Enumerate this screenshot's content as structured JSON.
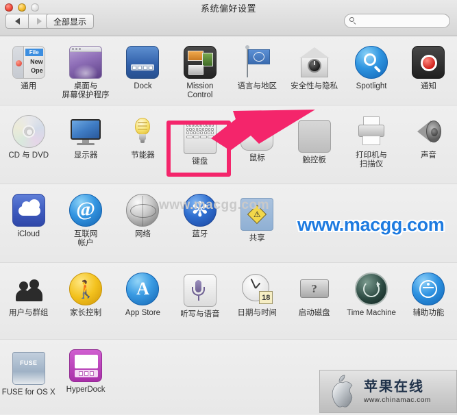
{
  "window": {
    "title": "系统偏好设置",
    "traffic_lights": [
      "close",
      "minimize",
      "zoom"
    ]
  },
  "toolbar": {
    "back_label": "◀",
    "forward_label": "▶",
    "show_all_label": "全部显示",
    "search": {
      "value": "",
      "placeholder": "",
      "icon": "search-icon"
    }
  },
  "rows": [
    {
      "items": [
        {
          "label": "通用",
          "icon": "general-icon",
          "file_text": "File",
          "new_text": "New",
          "open_text": "Ope"
        },
        {
          "label": "桌面与\n屏幕保护程序",
          "icon": "desktop-screensaver-icon"
        },
        {
          "label": "Dock",
          "icon": "dock-icon"
        },
        {
          "label": "Mission\nControl",
          "icon": "mission-control-icon"
        },
        {
          "label": "语言与地区",
          "icon": "language-region-icon"
        },
        {
          "label": "安全性与隐私",
          "icon": "security-privacy-icon"
        },
        {
          "label": "Spotlight",
          "icon": "spotlight-icon"
        },
        {
          "label": "通知",
          "icon": "notifications-icon"
        }
      ]
    },
    {
      "items": [
        {
          "label": "CD 与 DVD",
          "icon": "cd-dvd-icon"
        },
        {
          "label": "显示器",
          "icon": "displays-icon"
        },
        {
          "label": "节能器",
          "icon": "energy-saver-icon"
        },
        {
          "label": "键盘",
          "icon": "keyboard-icon",
          "highlighted": true
        },
        {
          "label": "鼠标",
          "icon": "mouse-icon"
        },
        {
          "label": "触控板",
          "icon": "trackpad-icon"
        },
        {
          "label": "打印机与\n扫描仪",
          "icon": "printers-scanners-icon"
        },
        {
          "label": "声音",
          "icon": "sound-icon"
        }
      ]
    },
    {
      "items": [
        {
          "label": "iCloud",
          "icon": "icloud-icon"
        },
        {
          "label": "互联网\n帐户",
          "icon": "internet-accounts-icon",
          "glyph": "@"
        },
        {
          "label": "网络",
          "icon": "network-icon"
        },
        {
          "label": "蓝牙",
          "icon": "bluetooth-icon",
          "glyph": "✼"
        },
        {
          "label": "共享",
          "icon": "sharing-icon",
          "glyph": "⚠"
        },
        {
          "label": "",
          "icon": ""
        },
        {
          "label": "",
          "icon": ""
        },
        {
          "label": "",
          "icon": ""
        }
      ]
    },
    {
      "items": [
        {
          "label": "用户与群组",
          "icon": "users-groups-icon"
        },
        {
          "label": "家长控制",
          "icon": "parental-controls-icon",
          "glyph": "🚶"
        },
        {
          "label": "App Store",
          "icon": "app-store-icon",
          "glyph": "A"
        },
        {
          "label": "听写与语音",
          "icon": "dictation-speech-icon"
        },
        {
          "label": "日期与时间",
          "icon": "date-time-icon",
          "calendar_day": "18"
        },
        {
          "label": "启动磁盘",
          "icon": "startup-disk-icon",
          "glyph": "?"
        },
        {
          "label": "Time Machine",
          "icon": "time-machine-icon"
        },
        {
          "label": "辅助功能",
          "icon": "accessibility-icon"
        }
      ]
    },
    {
      "items": [
        {
          "label": "FUSE for OS X",
          "icon": "fuse-icon",
          "glyph": "FUSE"
        },
        {
          "label": "HyperDock",
          "icon": "hyperdock-icon"
        },
        {
          "label": "",
          "icon": ""
        },
        {
          "label": "",
          "icon": ""
        },
        {
          "label": "",
          "icon": ""
        },
        {
          "label": "",
          "icon": ""
        },
        {
          "label": "",
          "icon": ""
        },
        {
          "label": "",
          "icon": ""
        }
      ]
    }
  ],
  "annotations": {
    "highlight_color": "#f4256b",
    "arrow_color": "#f4256b",
    "arrow_target": "keyboard-icon"
  },
  "watermarks": {
    "faint_text": "www.macgg.com",
    "blue_text": "www.macgg.com",
    "blue_color": "#1e7be0"
  },
  "badge": {
    "title": "苹果在线",
    "url": "www.chinamac.com",
    "logo": "apple-logo"
  }
}
